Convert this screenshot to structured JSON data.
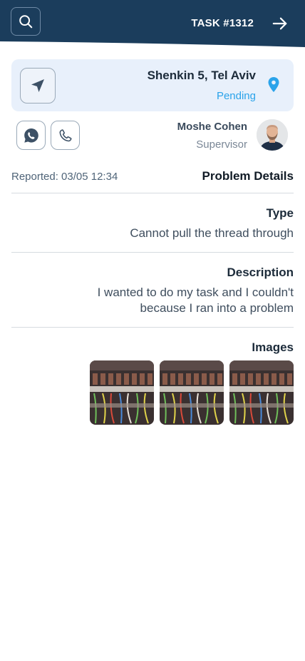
{
  "header": {
    "task_title": "TASK #1312",
    "bg_color": "#1b3d5c",
    "search_icon": "search-icon",
    "next_icon": "arrow-right-icon"
  },
  "location": {
    "address": "Shenkin 5, Tel Aviv",
    "status": "Pending",
    "status_color": "#2aa3ea",
    "nav_icon": "navigation-arrow-icon",
    "pin_icon": "map-pin-icon"
  },
  "contact": {
    "name": "Moshe Cohen",
    "role": "Supervisor",
    "whatsapp_icon": "whatsapp-icon",
    "phone_icon": "phone-icon"
  },
  "details": {
    "reported": "Reported: 03/05 12:34",
    "title": "Problem Details",
    "type_label": "Type",
    "type_value": "Cannot pull the thread through",
    "description_label": "Description",
    "description_value": "I wanted to do my task and I couldn't because I ran into a problem",
    "images_label": "Images",
    "image_count": 3
  }
}
